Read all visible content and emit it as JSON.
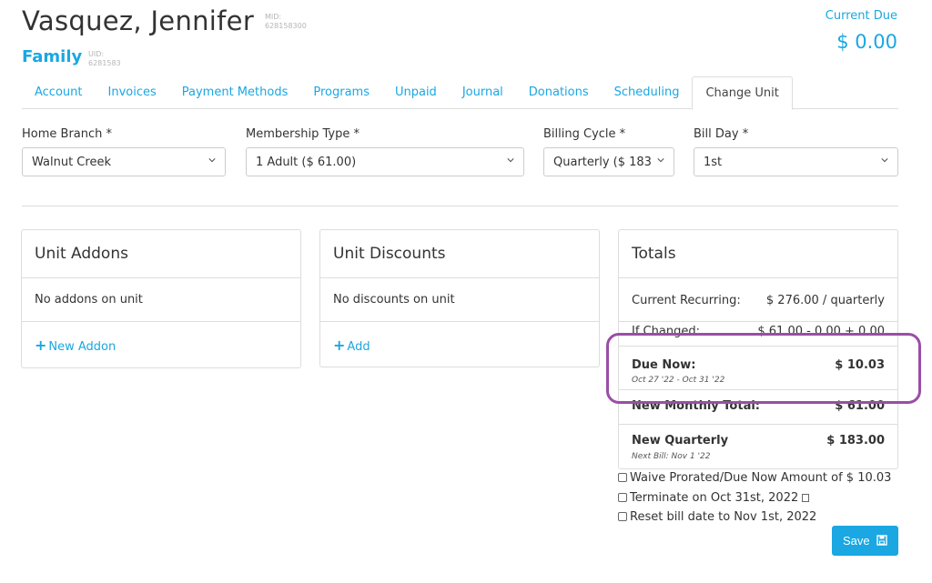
{
  "member": {
    "name": "Vasquez, Jennifer",
    "mid_label": "MID:",
    "mid_value": "628158300",
    "unit_type": "Family",
    "uid_label": "UID:",
    "uid_value": "6281583"
  },
  "current_due": {
    "label": "Current Due",
    "amount": "$ 0.00"
  },
  "tabs": [
    {
      "label": "Account"
    },
    {
      "label": "Invoices"
    },
    {
      "label": "Payment Methods"
    },
    {
      "label": "Programs"
    },
    {
      "label": "Unpaid"
    },
    {
      "label": "Journal"
    },
    {
      "label": "Donations"
    },
    {
      "label": "Scheduling"
    },
    {
      "label": "Change Unit",
      "active": true
    }
  ],
  "form": {
    "home_branch": {
      "label": "Home Branch *",
      "value": "Walnut Creek"
    },
    "membership_type": {
      "label": "Membership Type *",
      "value": "1 Adult ($ 61.00)"
    },
    "billing_cycle": {
      "label": "Billing Cycle *",
      "value": "Quarterly ($ 183"
    },
    "bill_day": {
      "label": "Bill Day *",
      "value": "1st"
    }
  },
  "addons": {
    "title": "Unit Addons",
    "empty_text": "No addons on unit",
    "add_label": "New Addon"
  },
  "discounts": {
    "title": "Unit Discounts",
    "empty_text": "No discounts on unit",
    "add_label": "Add"
  },
  "totals": {
    "title": "Totals",
    "current_recurring_label": "Current Recurring:",
    "current_recurring_value": "$ 276.00 / quarterly",
    "if_changed_label": "If Changed:",
    "if_changed_value": "$ 61.00 - 0.00 + 0.00",
    "due_now_label": "Due Now:",
    "due_now_value": "$ 10.03",
    "due_now_period": "Oct 27 '22 - Oct 31 '22",
    "new_monthly_label": "New Monthly Total:",
    "new_monthly_value": "$ 61.00",
    "new_quarterly_label": "New Quarterly",
    "new_quarterly_value": "$ 183.00",
    "next_bill": "Next Bill: Nov 1 '22"
  },
  "options": {
    "waive": "Waive Prorated/Due Now Amount of $ 10.03",
    "terminate": "Terminate on Oct 31st, 2022",
    "reset": "Reset bill date to Nov 1st, 2022"
  },
  "save_label": "Save",
  "colors": {
    "accent": "#1aa7e2",
    "highlight": "#9a4ea6"
  }
}
